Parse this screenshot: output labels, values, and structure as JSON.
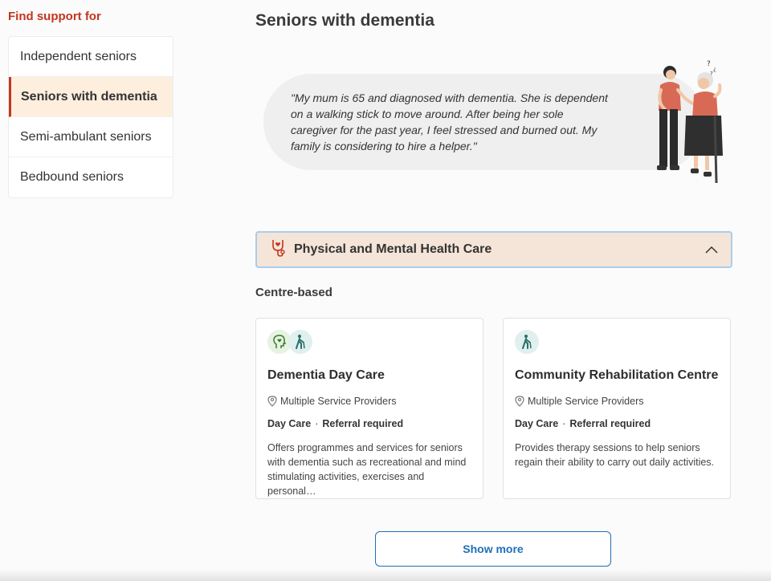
{
  "sidebar": {
    "title": "Find support for",
    "items": [
      {
        "label": "Independent seniors",
        "active": false
      },
      {
        "label": "Seniors with dementia",
        "active": true
      },
      {
        "label": "Semi-ambulant seniors",
        "active": false
      },
      {
        "label": "Bedbound seniors",
        "active": false
      }
    ]
  },
  "main": {
    "title": "Seniors with dementia",
    "quote": "\"My mum is 65 and diagnosed with dementia. She is dependent on a walking stick to move around. After being her sole caregiver for the past year, I feel stressed and burned out. My family is considering to hire a helper.\"",
    "accordion": {
      "title": "Physical and Mental Health Care",
      "icon": "stethoscope-heart-icon",
      "expanded": true
    },
    "section_label": "Centre-based",
    "cards": [
      {
        "icons": [
          "head-heart-icon",
          "walking-stick-icon"
        ],
        "title": "Dementia Day Care",
        "provider": "Multiple Service Providers",
        "tag1": "Day Care",
        "tag2": "Referral required",
        "description": "Offers programmes and services for seniors with dementia such as recreational and mind stimulating activities, exercises and personal…"
      },
      {
        "icons": [
          "walking-stick-icon"
        ],
        "title": "Community Rehabilitation Centre",
        "provider": "Multiple Service Providers",
        "tag1": "Day Care",
        "tag2": "Referral required",
        "description": "Provides therapy sessions to help seniors regain their ability to carry out daily activities."
      }
    ],
    "show_more_label": "Show more"
  },
  "colors": {
    "accent_red": "#c2361e",
    "active_bg": "#fdeedd",
    "accordion_bg": "#f4e5d8",
    "link_blue": "#1f6fb8",
    "icon_teal": "#2a6f6b",
    "icon_green": "#3d7a2c"
  }
}
